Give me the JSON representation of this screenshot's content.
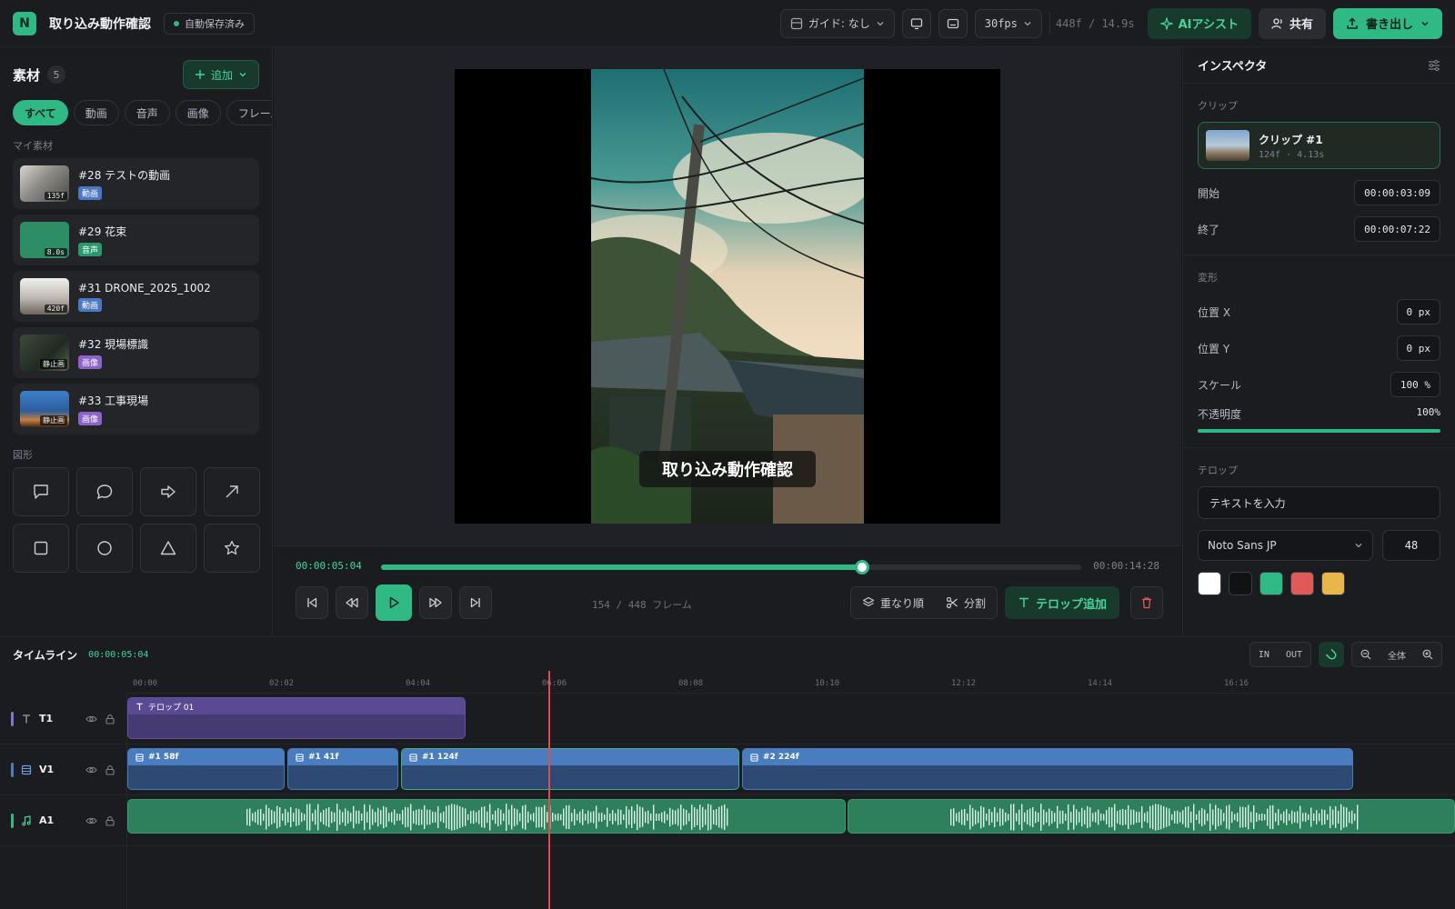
{
  "header": {
    "logo": "N",
    "title": "取り込み動作確認",
    "autosave": "自動保存済み",
    "guide": "ガイド: なし",
    "fps": "30fps",
    "duration": "448f / 14.9s",
    "ai_assist": "AIアシスト",
    "share": "共有",
    "export": "書き出し"
  },
  "assets_panel": {
    "title": "素材",
    "count": "5",
    "add": "追加",
    "filters": [
      "すべて",
      "動画",
      "音声",
      "画像",
      "フレーム"
    ],
    "my_assets_label": "マイ素材",
    "items": [
      {
        "name": "#28 テストの動画",
        "tag": "135f",
        "type": "動画"
      },
      {
        "name": "#29 花束",
        "tag": "8.0s",
        "type": "音声"
      },
      {
        "name": "#31 DRONE_2025_1002",
        "tag": "420f",
        "type": "動画"
      },
      {
        "name": "#32 現場標識",
        "tag": "静止画",
        "type": "画像"
      },
      {
        "name": "#33 工事現場",
        "tag": "静止画",
        "type": "画像"
      }
    ],
    "shapes_label": "図形",
    "shapes": [
      "speech-box-icon",
      "speech-bubble-icon",
      "arrow-right-icon",
      "arrow-diagonal-icon",
      "square-icon",
      "circle-icon",
      "triangle-icon",
      "star-icon"
    ]
  },
  "preview": {
    "caption": "取り込み動作確認"
  },
  "transport": {
    "current": "00:00:05:04",
    "end": "00:00:14:28",
    "progress": 0.6875,
    "frames": "154 / 448 フレーム",
    "layer_order": "重なり順",
    "split": "分割",
    "add_telop": "テロップ追加"
  },
  "inspector": {
    "title": "インスペクタ",
    "clip_section": "クリップ",
    "clip_name": "クリップ #1",
    "clip_frames": "124f",
    "clip_seconds": "4.13s",
    "start_label": "開始",
    "start_value": "00:00:03:09",
    "end_label": "終了",
    "end_value": "00:00:07:22",
    "transform_section": "変形",
    "pos_x_label": "位置 X",
    "pos_x_value": "0 px",
    "pos_y_label": "位置 Y",
    "pos_y_value": "0 px",
    "scale_label": "スケール",
    "scale_value": "100 %",
    "opacity_label": "不透明度",
    "opacity_value": "100%",
    "telop_section": "テロップ",
    "text_placeholder": "テキストを入力",
    "font": "Noto Sans JP",
    "font_size": "48",
    "colors": [
      "#ffffff",
      "#111214",
      "#2fb985",
      "#e05a5a",
      "#e8b64a"
    ]
  },
  "timeline": {
    "title": "タイムライン",
    "timecode": "00:00:05:04",
    "in": "IN",
    "out": "OUT",
    "zoom_all": "全体",
    "ruler": [
      "00:00",
      "02:02",
      "04:04",
      "06:06",
      "08:08",
      "10:10",
      "12:12",
      "14:14",
      "16:16"
    ],
    "tracks": [
      {
        "name": "T1",
        "color": "#8b6fd1"
      },
      {
        "name": "V1",
        "color": "#4a7cc0"
      },
      {
        "name": "A1",
        "color": "#2fb985"
      }
    ],
    "telop_clip": "テロップ 01",
    "video_clips": [
      "#1 58f",
      "#1 41f",
      "#1 124f",
      "#2 224f"
    ]
  }
}
